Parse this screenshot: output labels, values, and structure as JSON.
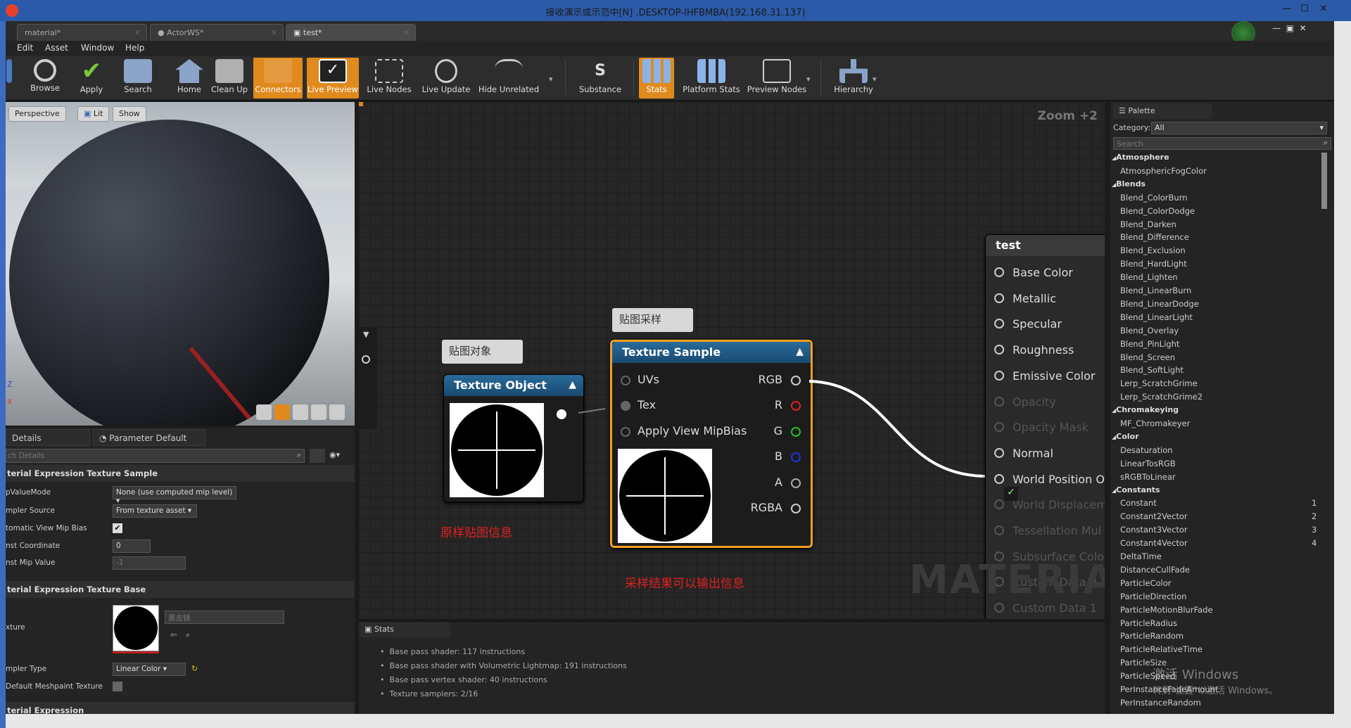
{
  "window": {
    "title": "接收演示或示范中[N] .DESKTOP-IHFBMBA(192.168.31.137)"
  },
  "tabs": [
    "material*",
    "ActorWS*",
    "test*"
  ],
  "menu": [
    "Edit",
    "Asset",
    "Window",
    "Help"
  ],
  "toolbar": [
    "Browse",
    "Apply",
    "Search",
    "Home",
    "Clean Up",
    "Connectors",
    "Live Preview",
    "Live Nodes",
    "Live Update",
    "Hide Unrelated",
    "Substance",
    "Stats",
    "Platform Stats",
    "Preview Nodes",
    "Hierarchy"
  ],
  "viewport": {
    "perspective": "Perspective",
    "lit": "Lit",
    "show": "Show",
    "axis_z": "Z",
    "axis_x": "X"
  },
  "details": {
    "tab1": "Details",
    "tab2": "Parameter Default",
    "search_placeholder": "ch Details",
    "sect1": "terial Expression Texture Sample",
    "p1": "pValueMode",
    "v1": "None (use computed mip level)",
    "p2": "mpler Source",
    "v2": "From texture asset",
    "p3": "tomatic View Mip Bias",
    "p4": "nst Coordinate",
    "v4": "0",
    "p5": "nst Mip Value",
    "v5": "-1",
    "sect2": "terial Expression Texture Base",
    "p6": "xture",
    "v6": "黑去镜",
    "p7": "mpler Type",
    "v7": "Linear Color",
    "p8": "Default Meshpaint Texture",
    "sect3": "terial Expression"
  },
  "graph": {
    "zoom": "Zoom +2",
    "watermark": "MATERIAL",
    "comment1": "贴图对象",
    "comment2": "贴图采样",
    "note1": "原样贴图信息",
    "note2": "采样结果可以输出信息",
    "tex_object": "Texture Object",
    "tex_sample": "Texture Sample",
    "in_uvs": "UVs",
    "in_tex": "Tex",
    "in_mip": "Apply View MipBias",
    "out_rgb": "RGB",
    "out_r": "R",
    "out_g": "G",
    "out_b": "B",
    "out_a": "A",
    "out_rgba": "RGBA",
    "result_title": "test",
    "result_pins": [
      "Base Color",
      "Metallic",
      "Specular",
      "Roughness",
      "Emissive Color",
      "Opacity",
      "Opacity Mask",
      "Normal",
      "World Position O",
      "World Displacem",
      "Tessellation Mul",
      "Subsurface Colo",
      "Custom Data 0",
      "Custom Data 1"
    ]
  },
  "stats": {
    "tab": "Stats",
    "lines": [
      "Base pass shader: 117 instructions",
      "Base pass shader with Volumetric Lightmap: 191 instructions",
      "Base pass vertex shader: 40 instructions",
      "Texture samplers: 2/16"
    ]
  },
  "palette": {
    "tab": "Palette",
    "category_label": "Category:",
    "category_value": "All",
    "search_placeholder": "Search",
    "items": [
      {
        "t": "cat",
        "l": "Atmosphere"
      },
      {
        "t": "i",
        "l": "AtmosphericFogColor"
      },
      {
        "t": "cat",
        "l": "Blends"
      },
      {
        "t": "i",
        "l": "Blend_ColorBurn"
      },
      {
        "t": "i",
        "l": "Blend_ColorDodge"
      },
      {
        "t": "i",
        "l": "Blend_Darken"
      },
      {
        "t": "i",
        "l": "Blend_Difference"
      },
      {
        "t": "i",
        "l": "Blend_Exclusion"
      },
      {
        "t": "i",
        "l": "Blend_HardLight"
      },
      {
        "t": "i",
        "l": "Blend_Lighten"
      },
      {
        "t": "i",
        "l": "Blend_LinearBurn"
      },
      {
        "t": "i",
        "l": "Blend_LinearDodge"
      },
      {
        "t": "i",
        "l": "Blend_LinearLight"
      },
      {
        "t": "i",
        "l": "Blend_Overlay"
      },
      {
        "t": "i",
        "l": "Blend_PinLight"
      },
      {
        "t": "i",
        "l": "Blend_Screen"
      },
      {
        "t": "i",
        "l": "Blend_SoftLight"
      },
      {
        "t": "i",
        "l": "Lerp_ScratchGrime"
      },
      {
        "t": "i",
        "l": "Lerp_ScratchGrime2"
      },
      {
        "t": "cat",
        "l": "Chromakeying"
      },
      {
        "t": "i",
        "l": "MF_Chromakeyer"
      },
      {
        "t": "cat",
        "l": "Color"
      },
      {
        "t": "i",
        "l": "Desaturation"
      },
      {
        "t": "i",
        "l": "LinearTosRGB"
      },
      {
        "t": "i",
        "l": "sRGBToLinear"
      },
      {
        "t": "cat",
        "l": "Constants"
      },
      {
        "t": "i",
        "l": "Constant",
        "k": "1"
      },
      {
        "t": "i",
        "l": "Constant2Vector",
        "k": "2"
      },
      {
        "t": "i",
        "l": "Constant3Vector",
        "k": "3"
      },
      {
        "t": "i",
        "l": "Constant4Vector",
        "k": "4"
      },
      {
        "t": "i",
        "l": "DeltaTime"
      },
      {
        "t": "i",
        "l": "DistanceCullFade"
      },
      {
        "t": "i",
        "l": "ParticleColor"
      },
      {
        "t": "i",
        "l": "ParticleDirection"
      },
      {
        "t": "i",
        "l": "ParticleMotionBlurFade"
      },
      {
        "t": "i",
        "l": "ParticleRadius"
      },
      {
        "t": "i",
        "l": "ParticleRandom"
      },
      {
        "t": "i",
        "l": "ParticleRelativeTime"
      },
      {
        "t": "i",
        "l": "ParticleSize"
      },
      {
        "t": "i",
        "l": "ParticleSpeed"
      },
      {
        "t": "i",
        "l": "PerInstanceFadeAmount"
      },
      {
        "t": "i",
        "l": "PerInstanceRandom"
      }
    ]
  },
  "activation": {
    "line1": "激活 Windows",
    "line2": "转到\"设置\"以激活 Windows。"
  }
}
